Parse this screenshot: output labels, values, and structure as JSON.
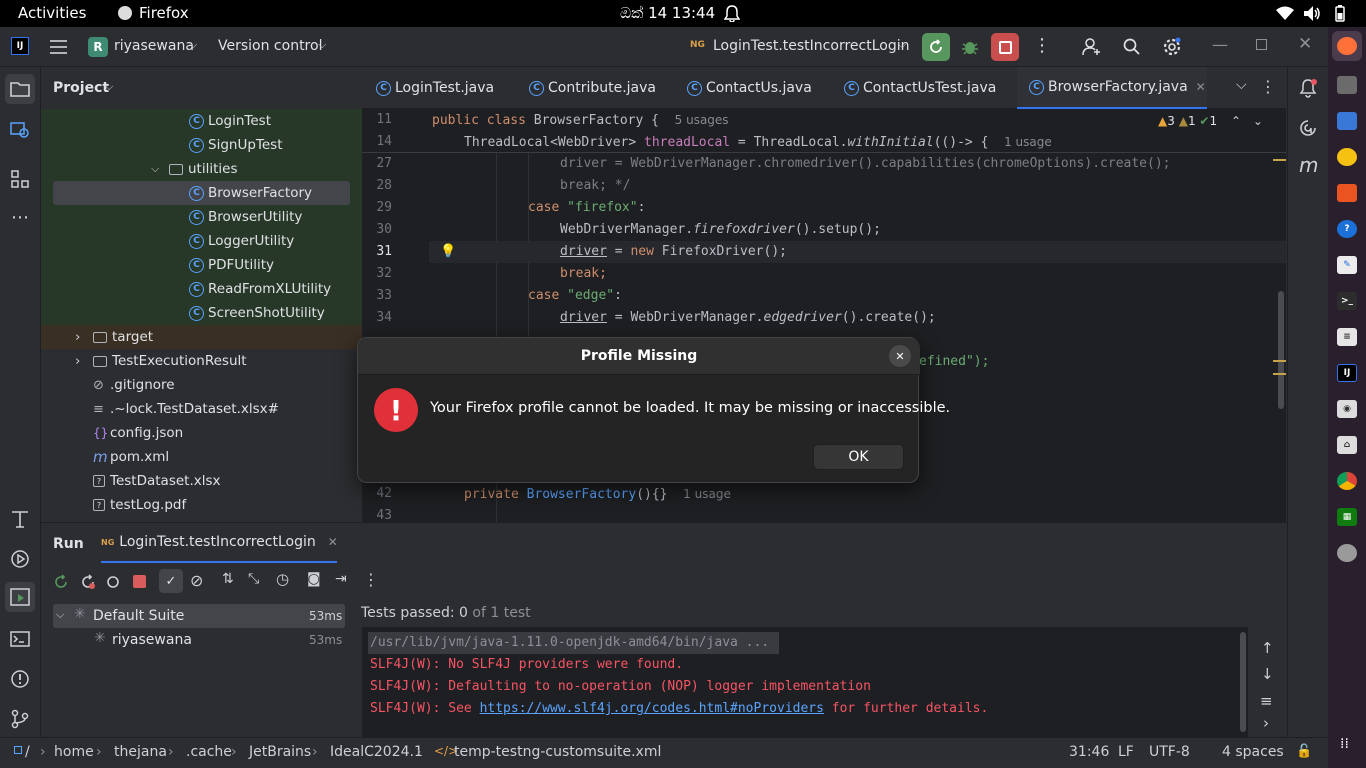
{
  "topbar": {
    "activities": "Activities",
    "app_name": "Firefox",
    "clock": "ඔක් 14  13:44"
  },
  "titlebar": {
    "project_letter": "R",
    "project_name": "riyasewana",
    "vcs": "Version control",
    "run_config": "LoginTest.testIncorrectLogin"
  },
  "project_panel": {
    "title": "Project",
    "items": [
      {
        "label": "LoginTest",
        "kind": "class"
      },
      {
        "label": "SignUpTest",
        "kind": "class"
      },
      {
        "label": "utilities",
        "kind": "package"
      },
      {
        "label": "BrowserFactory",
        "kind": "class"
      },
      {
        "label": "BrowserUtility",
        "kind": "class"
      },
      {
        "label": "LoggerUtility",
        "kind": "class"
      },
      {
        "label": "PDFUtility",
        "kind": "class"
      },
      {
        "label": "ReadFromXLUtility",
        "kind": "class"
      },
      {
        "label": "ScreenShotUtility",
        "kind": "class"
      },
      {
        "label": "target",
        "kind": "folder"
      },
      {
        "label": "TestExecutionResult",
        "kind": "folder"
      },
      {
        "label": ".gitignore",
        "kind": "ignore"
      },
      {
        "label": ".~lock.TestDataset.xlsx#",
        "kind": "text"
      },
      {
        "label": "config.json",
        "kind": "json"
      },
      {
        "label": "pom.xml",
        "kind": "maven"
      },
      {
        "label": "TestDataset.xlsx",
        "kind": "unknown"
      },
      {
        "label": "testLog.pdf",
        "kind": "unknown"
      }
    ]
  },
  "tabs": [
    {
      "label": "LoginTest.java"
    },
    {
      "label": "Contribute.java"
    },
    {
      "label": "ContactUs.java"
    },
    {
      "label": "ContactUsTest.java"
    },
    {
      "label": "BrowserFactory.java",
      "active": true
    }
  ],
  "editor": {
    "warnings": "3",
    "weak_warnings": "1",
    "ok": "1",
    "lines": {
      "l11": "11",
      "l14": "14",
      "l27": "27",
      "l28": "28",
      "l29": "29",
      "l30": "30",
      "l31": "31",
      "l32": "32",
      "l33": "33",
      "l34": "34",
      "l42": "42",
      "l43": "43"
    },
    "sticky1_a": "public class ",
    "sticky1_b": "BrowserFactory {",
    "sticky1_hint": "5 usages",
    "sticky2_a": "ThreadLocal<WebDriver> ",
    "sticky2_b": "threadLocal",
    "sticky2_c": " = ThreadLocal.",
    "sticky2_d": "withInitial",
    "sticky2_e": "(()-> {",
    "sticky2_hint": "1 usage",
    "c27": "driver = WebDriverManager.chromedriver().capabilities(chromeOptions).create();",
    "c28": "break; */",
    "c29_kw": "case ",
    "c29_str": "\"firefox\"",
    "c29_end": ":",
    "c30_a": "WebDriverManager.",
    "c30_b": "firefoxdriver",
    "c30_c": "().setup();",
    "c31_a": "driver",
    "c31_b": " = ",
    "c31_kw": "new ",
    "c31_c": "FirefoxDriver();",
    "c32": "break;",
    "c33_kw": "case ",
    "c33_str": "\"edge\"",
    "c33_end": ":",
    "c34_a": "driver",
    "c34_b": " = WebDriverManager.",
    "c34_c": "edgedriver",
    "c34_d": "().create();",
    "c_frag": "efined\");",
    "c42_kw": "private ",
    "c42_a": "BrowserFactory",
    "c42_b": "(){}",
    "c42_hint": "1 usage"
  },
  "run_panel": {
    "title": "Run",
    "tab_label": "LoginTest.testIncorrectLogin",
    "suite_name": "Default Suite",
    "suite_time": "53ms",
    "child_name": "riyasewana",
    "child_time": "53ms",
    "tests_passed_label": "Tests passed: ",
    "tests_passed_count": "0",
    "tests_passed_of": " of 1 test",
    "console": {
      "cmd": "/usr/lib/jvm/java-1.11.0-openjdk-amd64/bin/java ...",
      "line1": "SLF4J(W): No SLF4J providers were found.",
      "line2": "SLF4J(W): Defaulting to no-operation (NOP) logger implementation",
      "line3_a": "SLF4J(W): See ",
      "line3_link": "https://www.slf4j.org/codes.html#noProviders",
      "line3_b": " for further details."
    }
  },
  "statusbar": {
    "crumbs": [
      "/",
      "home",
      "thejana",
      ".cache",
      "JetBrains",
      "IdealC2024.1",
      "temp-testng-customsuite.xml"
    ],
    "position": "31:46",
    "line_sep": "LF",
    "encoding": "UTF-8",
    "indent": "4 spaces"
  },
  "dialog": {
    "title": "Profile Missing",
    "message": "Your Firefox profile cannot be loaded. It may be missing or inaccessible.",
    "ok_label": "OK"
  },
  "colors": {
    "accent_blue": "#3574f0",
    "run_green": "#57965c",
    "stop_red": "#db5c5c",
    "error_red": "#e0303a"
  }
}
